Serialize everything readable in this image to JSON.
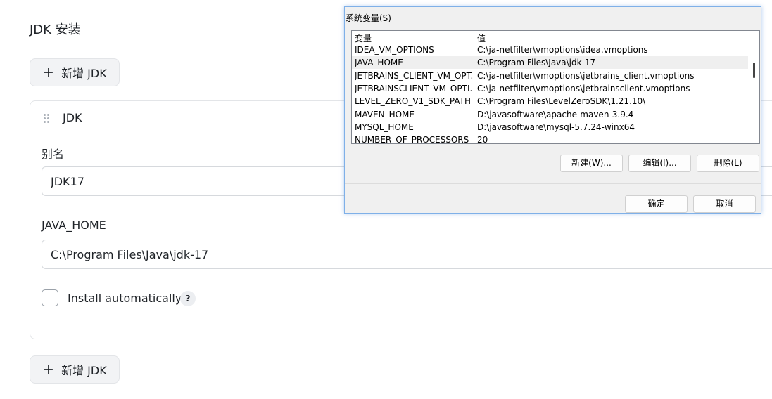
{
  "page": {
    "title": "JDK 安装",
    "add_button_label": "新增 JDK"
  },
  "jdk_card": {
    "title": "JDK",
    "alias_label": "别名",
    "alias_value": "JDK17",
    "java_home_label": "JAVA_HOME",
    "java_home_value": "C:\\Program Files\\Java\\jdk-17",
    "install_auto_label": "Install automatically",
    "install_auto_checked": false,
    "help_label": "?"
  },
  "dialog": {
    "group_label": "系统变量(S)",
    "columns": [
      "变量",
      "值"
    ],
    "rows": [
      {
        "name": "IDEA_VM_OPTIONS",
        "value": "C:\\ja-netfilter\\vmoptions\\idea.vmoptions"
      },
      {
        "name": "JAVA_HOME",
        "value": "C:\\Program Files\\Java\\jdk-17",
        "selected": true
      },
      {
        "name": "JETBRAINS_CLIENT_VM_OPT...",
        "value": "C:\\ja-netfilter\\vmoptions\\jetbrains_client.vmoptions"
      },
      {
        "name": "JETBRAINSCLIENT_VM_OPTI...",
        "value": "C:\\ja-netfilter\\vmoptions\\jetbrainsclient.vmoptions"
      },
      {
        "name": "LEVEL_ZERO_V1_SDK_PATH",
        "value": "C:\\Program Files\\LevelZeroSDK\\1.21.10\\"
      },
      {
        "name": "MAVEN_HOME",
        "value": "D:\\javasoftware\\apache-maven-3.9.4"
      },
      {
        "name": "MYSQL_HOME",
        "value": "D:\\javasoftware\\mysql-5.7.24-winx64"
      },
      {
        "name": "NUMBER_OF_PROCESSORS",
        "value": "20"
      }
    ],
    "buttons": {
      "new": "新建(W)...",
      "edit": "编辑(I)...",
      "delete": "删除(L)",
      "ok": "确定",
      "cancel": "取消"
    }
  }
}
